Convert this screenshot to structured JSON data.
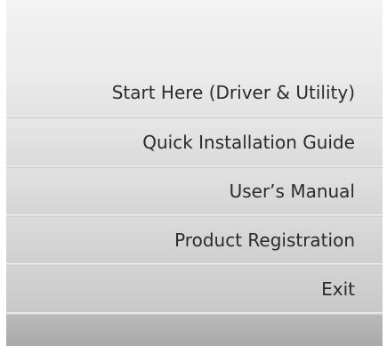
{
  "menu": {
    "items": [
      {
        "label": "Start Here (Driver & Utility)"
      },
      {
        "label": "Quick Installation Guide"
      },
      {
        "label": "User’s Manual"
      },
      {
        "label": "Product Registration"
      },
      {
        "label": "Exit"
      }
    ]
  },
  "colors": {
    "text": "#2b2b2b",
    "panel_top": "#f1f1f1",
    "panel_bottom": "#b4b4b4"
  }
}
